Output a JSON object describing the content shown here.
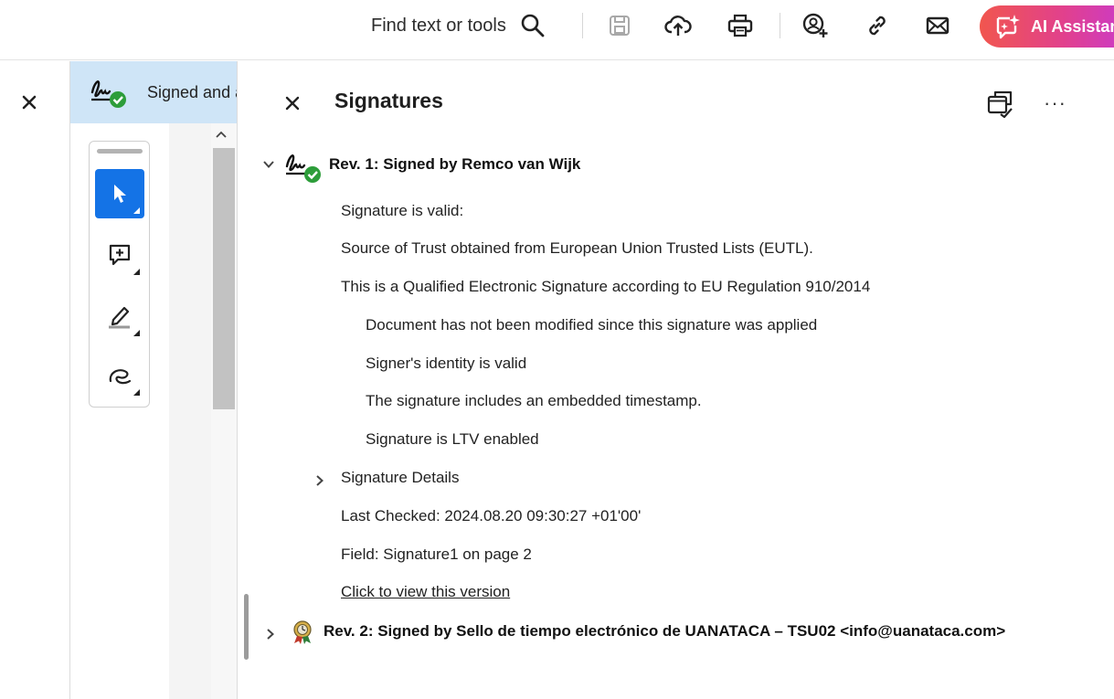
{
  "toolbar": {
    "find_label": "Find text or tools",
    "ai_label": "AI Assistant"
  },
  "left_panel": {
    "signed_label": "Signed and all signatures are valid"
  },
  "signatures_panel": {
    "title": "Signatures",
    "rev1": {
      "title": "Rev. 1: Signed by Remco van Wijk",
      "lines": [
        "Signature is valid:",
        "Source of Trust obtained from European Union Trusted Lists (EUTL).",
        "This is a Qualified Electronic Signature according to EU Regulation 910/2014"
      ],
      "sub_lines": [
        "Document has not been modified since this signature was applied",
        "Signer's identity is valid",
        "The signature includes an embedded timestamp.",
        "Signature is LTV enabled"
      ],
      "details_label": "Signature Details",
      "last_checked": "Last Checked: 2024.08.20 09:30:27 +01'00'",
      "field": "Field: Signature1 on page 2",
      "view_link": "Click to view this version"
    },
    "rev2": {
      "title": "Rev. 2: Signed by Sello de tiempo electrónico de UANATACA – TSU02 <info@uanataca.com>"
    }
  },
  "colors": {
    "accent": "#1473e6",
    "signed_bar": "#cfe5f7",
    "valid_green": "#2d9d3a"
  }
}
